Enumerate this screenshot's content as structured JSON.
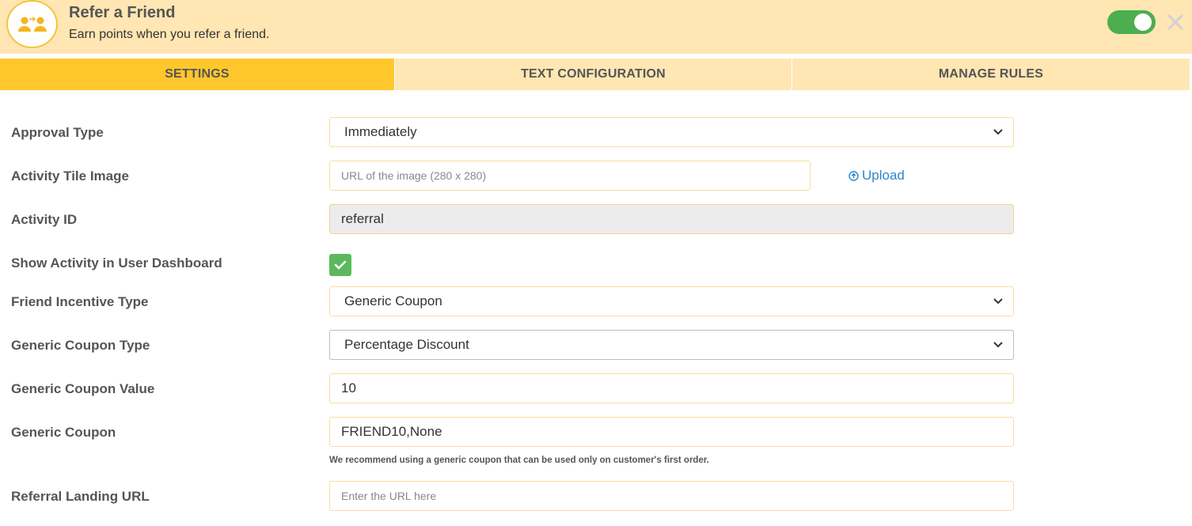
{
  "header": {
    "title": "Refer a Friend",
    "subtitle": "Earn points when you refer a friend.",
    "avatar_icon": "people-refer-icon",
    "toggle_state": "on",
    "close_icon": "close-icon"
  },
  "tabs": [
    {
      "label": "SETTINGS",
      "active": true
    },
    {
      "label": "TEXT CONFIGURATION",
      "active": false
    },
    {
      "label": "MANAGE RULES",
      "active": false
    }
  ],
  "form": {
    "approval_type": {
      "label": "Approval Type",
      "value": "Immediately"
    },
    "activity_tile_image": {
      "label": "Activity Tile Image",
      "value": "",
      "placeholder": "URL of the image (280 x 280)",
      "upload_label": "Upload"
    },
    "activity_id": {
      "label": "Activity ID",
      "value": "referral"
    },
    "show_in_dashboard": {
      "label": "Show Activity in User Dashboard",
      "checked": true
    },
    "friend_incentive_type": {
      "label": "Friend Incentive Type",
      "value": "Generic Coupon"
    },
    "generic_coupon_type": {
      "label": "Generic Coupon Type",
      "value": "Percentage Discount"
    },
    "generic_coupon_value": {
      "label": "Generic Coupon Value",
      "value": "10"
    },
    "generic_coupon": {
      "label": "Generic Coupon",
      "value": "FRIEND10,None",
      "hint": "We recommend using a generic coupon that can be used only on customer's first order."
    },
    "referral_landing_url": {
      "label": "Referral Landing URL",
      "value": "",
      "placeholder": "Enter the URL here"
    }
  },
  "colors": {
    "header_bg": "#ffe6b3",
    "tab_active": "#ffc72c",
    "toggle_on": "#4cae4f",
    "checkbox": "#5cb85c",
    "link": "#2e86c9"
  }
}
